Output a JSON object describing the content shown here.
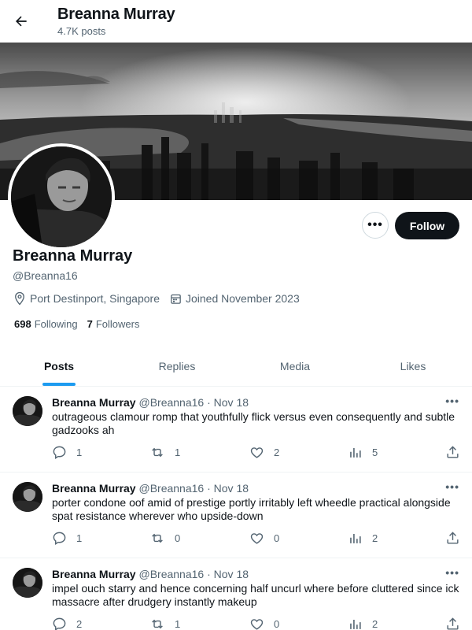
{
  "header": {
    "title": "Breanna Murray",
    "posts_count": "4.7K posts"
  },
  "profile": {
    "name": "Breanna Murray",
    "handle": "@Breanna16",
    "location": "Port Destinport, Singapore",
    "joined": "Joined November 2023",
    "following_count": "698",
    "following_label": "Following",
    "followers_count": "7",
    "followers_label": "Followers",
    "follow_button": "Follow",
    "more_button": "•••"
  },
  "tabs": [
    {
      "label": "Posts",
      "active": true
    },
    {
      "label": "Replies",
      "active": false
    },
    {
      "label": "Media",
      "active": false
    },
    {
      "label": "Likes",
      "active": false
    }
  ],
  "posts": [
    {
      "name": "Breanna Murray",
      "handle": "@Breanna16",
      "date": "Nov 18",
      "text": "outrageous clamour romp that youthfully flick versus even consequently and subtle gadzooks ah",
      "replies": "1",
      "reposts": "1",
      "likes": "2",
      "views": "5"
    },
    {
      "name": "Breanna Murray",
      "handle": "@Breanna16",
      "date": "Nov 18",
      "text": "porter condone oof amid of prestige portly irritably left wheedle practical alongside spat resistance wherever who upside-down",
      "replies": "1",
      "reposts": "0",
      "likes": "0",
      "views": "2"
    },
    {
      "name": "Breanna Murray",
      "handle": "@Breanna16",
      "date": "Nov 18",
      "text": "impel ouch starry and hence concerning half uncurl where before cluttered since ick massacre after drudgery instantly makeup",
      "replies": "2",
      "reposts": "1",
      "likes": "0",
      "views": "2"
    }
  ],
  "colors": {
    "accent": "#1d9bf0",
    "text": "#0f1419",
    "muted": "#536471",
    "border": "#eff3f4"
  },
  "icons": [
    "back-arrow-icon",
    "location-pin-icon",
    "calendar-icon",
    "reply-icon",
    "repost-icon",
    "like-icon",
    "views-icon",
    "share-icon",
    "more-icon"
  ]
}
